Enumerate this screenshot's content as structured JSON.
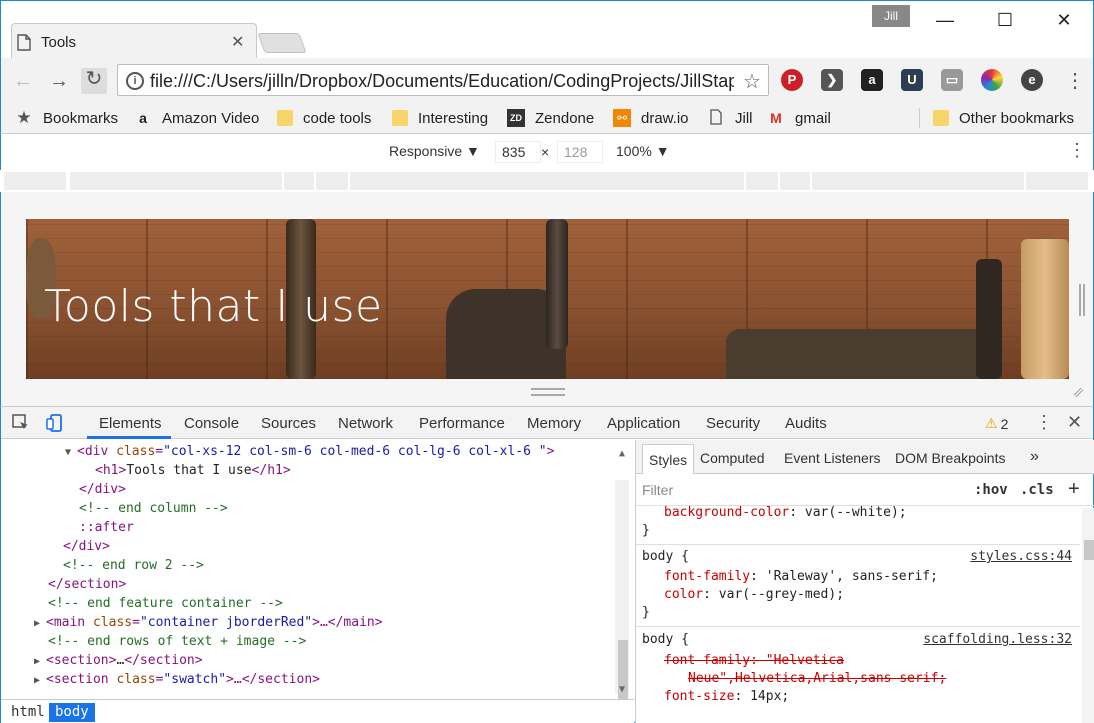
{
  "browser": {
    "tab_title": "Tools",
    "profile_badge": "Jill",
    "url": "file:///C:/Users/jilln/Dropbox/Documents/Education/CodingProjects/JillStapl",
    "bookmarks_label": "Bookmarks",
    "bookmarks": [
      {
        "label": "Amazon Video",
        "icon": "amazon-icon"
      },
      {
        "label": "code tools",
        "icon": "folder-icon"
      },
      {
        "label": "Interesting",
        "icon": "folder-icon"
      },
      {
        "label": "Zendone",
        "icon": "zendone-icon"
      },
      {
        "label": "draw.io",
        "icon": "drawio-icon"
      },
      {
        "label": "Jill",
        "icon": "page-icon"
      },
      {
        "label": "gmail",
        "icon": "gmail-icon"
      }
    ],
    "other_bookmarks": "Other bookmarks"
  },
  "device_toolbar": {
    "mode": "Responsive ▼",
    "width": "835",
    "times": "×",
    "height": "128",
    "zoom": "100% ▼"
  },
  "page": {
    "hero_title": "Tools that I use"
  },
  "devtools": {
    "tabs": [
      "Elements",
      "Console",
      "Sources",
      "Network",
      "Performance",
      "Memory",
      "Application",
      "Security",
      "Audits"
    ],
    "warning_count": "2",
    "dom_lines": {
      "l1_tag_open": "<div ",
      "l1_attr": "class",
      "l1_val": "\"col-xs-12 col-sm-6 col-med-6 col-lg-6 col-xl-6 \"",
      "l1_close": ">",
      "l2_open": "<h1>",
      "l2_text": "Tools that I use",
      "l2_close": "</h1>",
      "l3": "</div>",
      "l4": "<!-- end column -->",
      "l5": "::after",
      "l6": "</div>",
      "l7": "<!-- end row 2 -->",
      "l8": "</section>",
      "l9": "<!-- end feature container -->",
      "l10_open": "<main ",
      "l10_attr": "class",
      "l10_val": "\"container jborderRed\"",
      "l10_mid": ">…",
      "l10_close": "</main>",
      "l11": "<!-- end rows of text + image -->",
      "l12_open": "<section>",
      "l12_mid": "…",
      "l12_close": "</section>",
      "l13_open": "<section ",
      "l13_attr": "class",
      "l13_val": "\"swatch\"",
      "l13_mid": ">…",
      "l13_close": "</section>"
    },
    "breadcrumbs": [
      "html",
      "body"
    ],
    "styles_tabs": [
      "Styles",
      "Computed",
      "Event Listeners",
      "DOM Breakpoints"
    ],
    "filter_placeholder": "Filter",
    "hov": ":hov",
    "cls": ".cls",
    "rules": {
      "r0_prop": "background-color",
      "r0_val": ": var(--white);",
      "r0_end": "}",
      "r1_sel": "body {",
      "r1_src": "styles.css:44",
      "r1_p1": "font-family",
      "r1_v1": ": 'Raleway', sans-serif;",
      "r1_p2": "color",
      "r1_v2": ": var(--grey-med);",
      "r1_end": "}",
      "r2_sel": "body {",
      "r2_src": "scaffolding.less:32",
      "r2_p1": "font-family: \"Helvetica",
      "r2_p1b": "Neue\",Helvetica,Arial,sans-serif;",
      "r2_p2": "font-size",
      "r2_v2": ": 14px;"
    }
  }
}
